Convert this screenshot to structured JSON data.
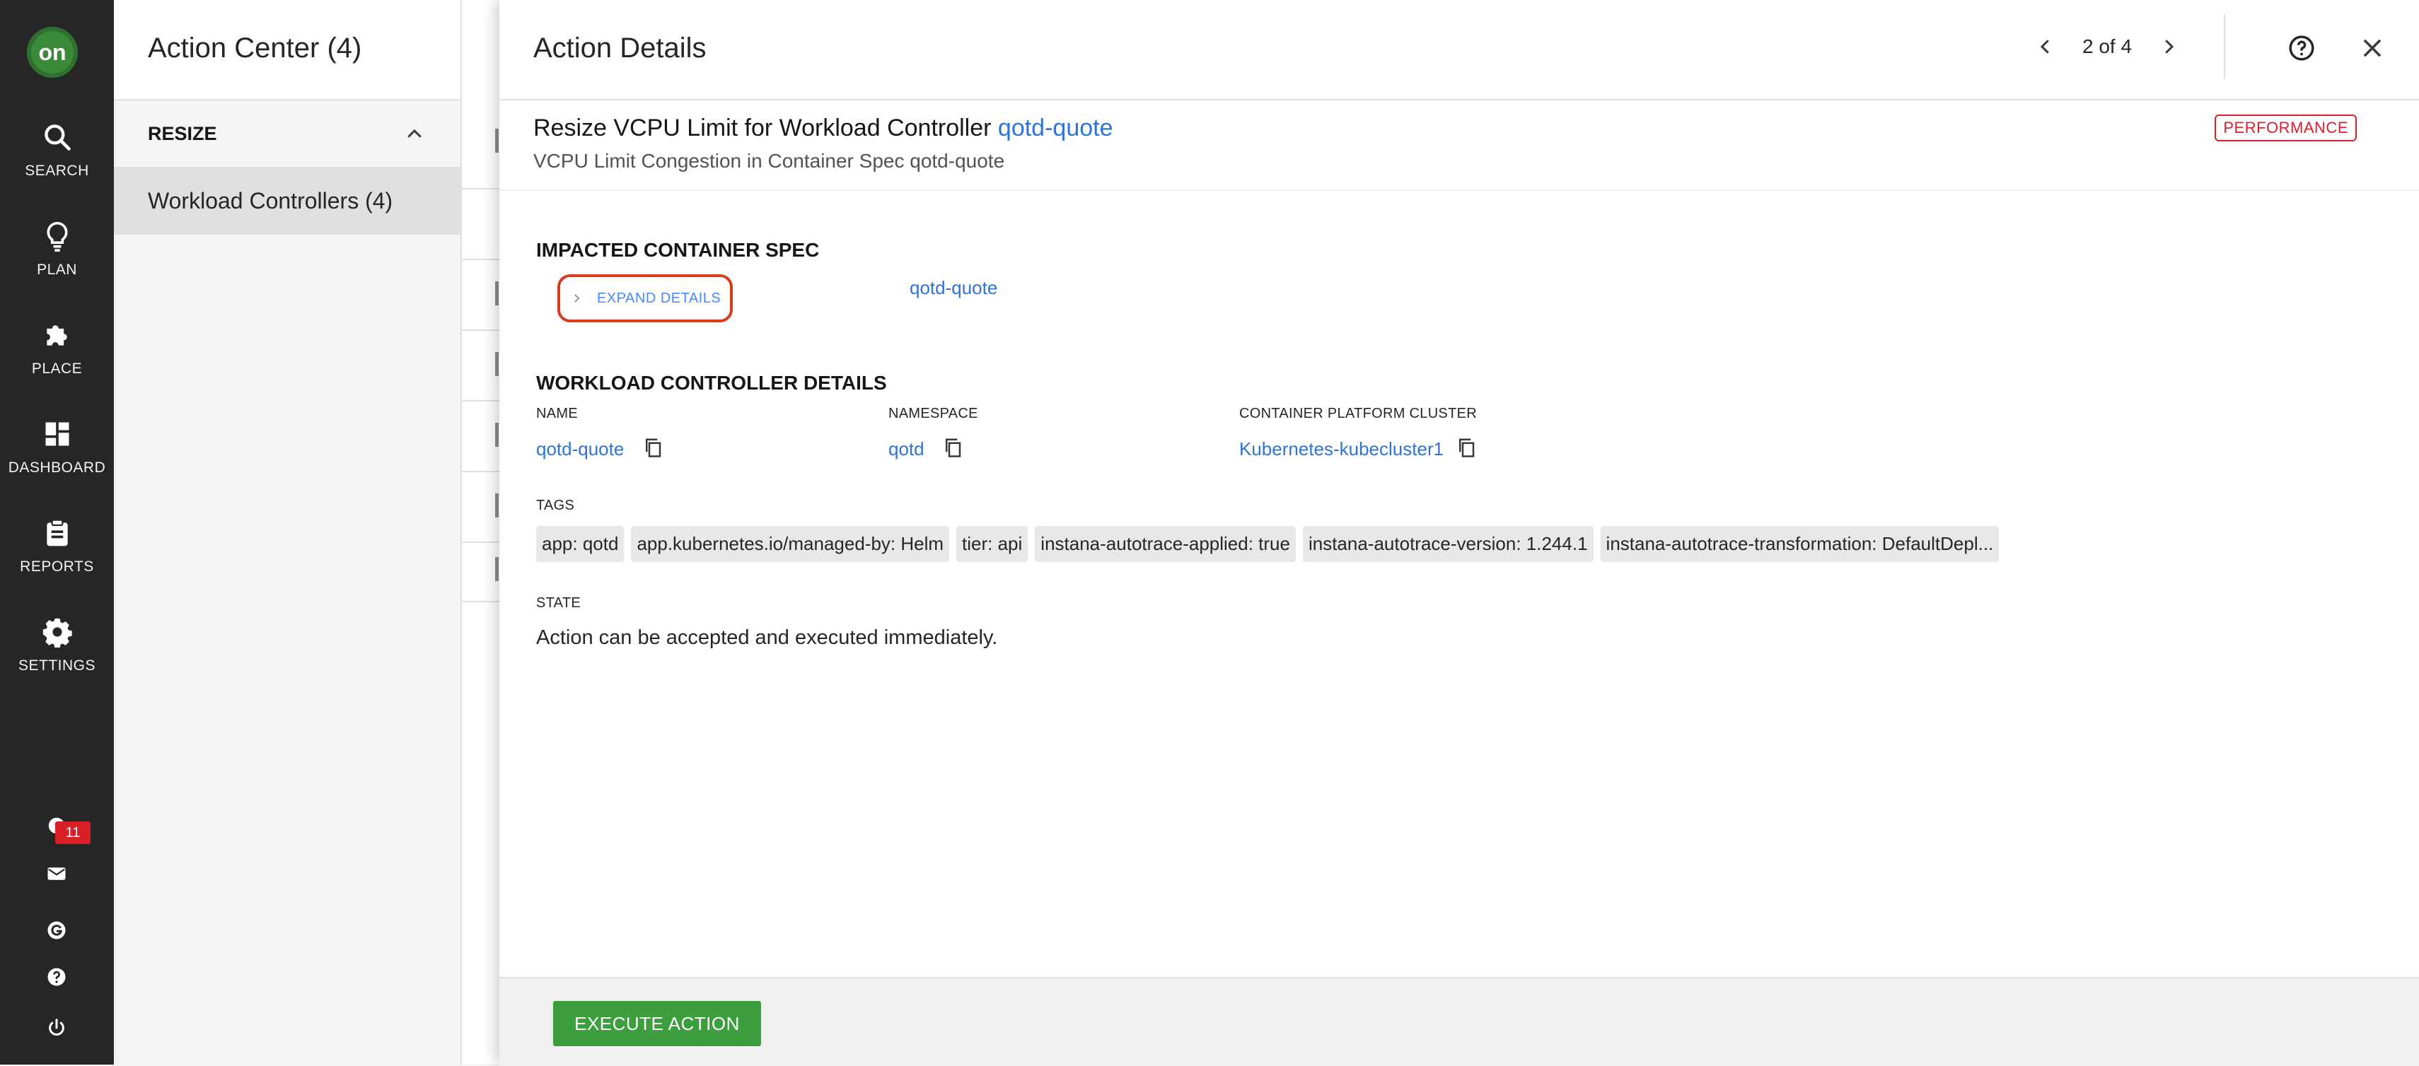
{
  "nav": {
    "logo_text": "on",
    "items": [
      {
        "label": "SEARCH",
        "icon": "search-icon"
      },
      {
        "label": "PLAN",
        "icon": "lightbulb-icon"
      },
      {
        "label": "PLACE",
        "icon": "puzzle-icon"
      },
      {
        "label": "DASHBOARD",
        "icon": "dashboard-icon"
      },
      {
        "label": "REPORTS",
        "icon": "clipboard-icon"
      },
      {
        "label": "SETTINGS",
        "icon": "gear-icon"
      }
    ],
    "notification_count": "11",
    "utility_icons": [
      "notification-icon",
      "mail-icon",
      "g-icon",
      "help-icon",
      "power-icon"
    ]
  },
  "action_center": {
    "title": "Action Center (4)",
    "group_label": "RESIZE",
    "item_label": "Workload Controllers (4)"
  },
  "details": {
    "title": "Action Details",
    "pager": "2 of 4",
    "action_prefix": "Resize VCPU Limit for Workload Controller",
    "action_link": "qotd-quote",
    "action_subtitle": "VCPU Limit Congestion in Container Spec qotd-quote",
    "badge": "PERFORMANCE",
    "impacted_title": "IMPACTED CONTAINER SPEC",
    "expand_label": "EXPAND DETAILS",
    "impacted_value": "qotd-quote",
    "controller_title": "WORKLOAD CONTROLLER DETAILS",
    "fields": {
      "name_label": "NAME",
      "name_value": "qotd-quote",
      "namespace_label": "NAMESPACE",
      "namespace_value": "qotd",
      "cluster_label": "CONTAINER PLATFORM CLUSTER",
      "cluster_value": "Kubernetes-kubecluster1"
    },
    "tags_label": "TAGS",
    "tags": [
      "app: qotd",
      "app.kubernetes.io/managed-by: Helm",
      "tier: api",
      "instana-autotrace-applied: true",
      "instana-autotrace-version: 1.244.1",
      "instana-autotrace-transformation: DefaultDepl..."
    ],
    "state_label": "STATE",
    "state_value": "Action can be accepted and executed immediately.",
    "execute_label": "EXECUTE ACTION"
  },
  "colors": {
    "nav_bg": "#262626",
    "link": "#2d74da",
    "badge_red": "#da1e28",
    "execute_green": "#3c9e3c"
  }
}
